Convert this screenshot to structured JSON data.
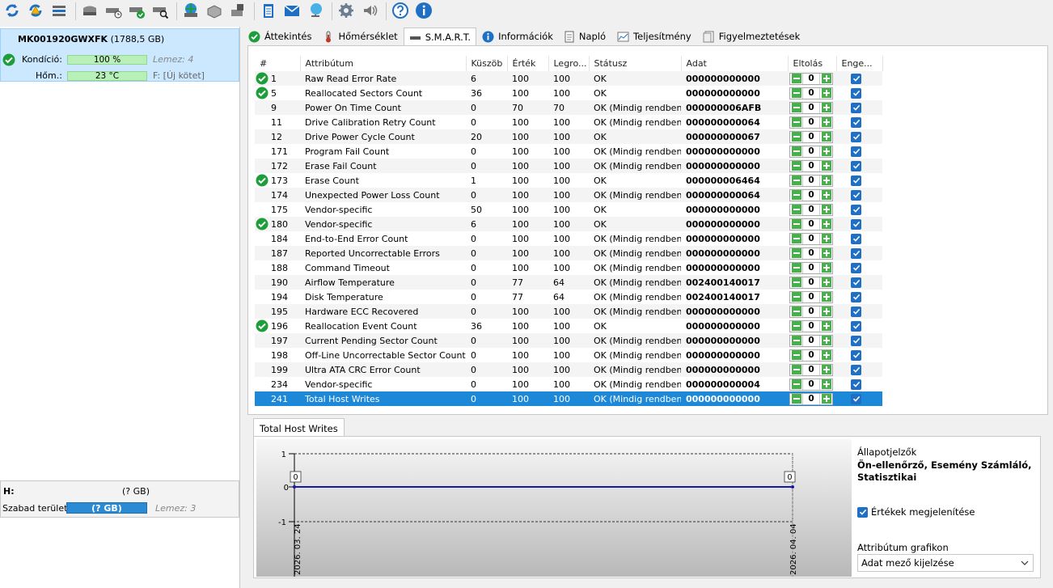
{
  "toolbar": {
    "icons": [
      "refresh-icon",
      "refresh-warning-icon",
      "disk-list-icon",
      "drive-icon",
      "drive-clock-icon",
      "drive-check-icon",
      "drive-search-icon",
      "network-drive-icon",
      "drive-alt-icon",
      "drive-export-icon",
      "notepad-icon",
      "mail-icon",
      "network-icon",
      "settings-icon",
      "speaker-icon",
      "help-icon",
      "info-icon"
    ]
  },
  "drive": {
    "model": "MK001920GWXFK",
    "size": "(1788,5 GB)",
    "condition_label": "Kondíció:",
    "condition_value": "100 %",
    "condition_percent": 100,
    "disk_label": "Lemez: 4",
    "temp_label": "Hőm.:",
    "temp_value": "23 °C",
    "volume_label": "F: [Új kötet]"
  },
  "volume": {
    "letter": "H:",
    "size": "(? GB)",
    "free_label": "Szabad terület",
    "free_value": "(? GB)",
    "disk_label": "Lemez: 3"
  },
  "tabs": [
    {
      "label": "Áttekintés",
      "icon": "check-icon"
    },
    {
      "label": "Hőmérséklet",
      "icon": "thermometer-icon"
    },
    {
      "label": "S.M.A.R.T.",
      "icon": "drive-icon",
      "active": true
    },
    {
      "label": "Információk",
      "icon": "info-icon"
    },
    {
      "label": "Napló",
      "icon": "document-icon"
    },
    {
      "label": "Teljesítmény",
      "icon": "performance-icon"
    },
    {
      "label": "Figyelmeztetések",
      "icon": "warning-list-icon"
    }
  ],
  "table": {
    "headers": [
      "#",
      "Attribútum",
      "Küszöb",
      "Érték",
      "Legro...",
      "Státusz",
      "Adat",
      "Eltolás",
      "Enge..."
    ],
    "rows": [
      {
        "id": "1",
        "name": "Raw Read Error Rate",
        "threshold": "6",
        "value": "100",
        "worst": "100",
        "status": "OK",
        "data": "000000000000",
        "offset": "0",
        "ok": true
      },
      {
        "id": "5",
        "name": "Reallocated Sectors Count",
        "threshold": "36",
        "value": "100",
        "worst": "100",
        "status": "OK",
        "data": "000000000000",
        "offset": "0",
        "ok": true
      },
      {
        "id": "9",
        "name": "Power On Time Count",
        "threshold": "0",
        "value": "70",
        "worst": "70",
        "status": "OK (Mindig rendben)",
        "data": "000000006AFB",
        "offset": "0",
        "ok": false
      },
      {
        "id": "11",
        "name": "Drive Calibration Retry Count",
        "threshold": "0",
        "value": "100",
        "worst": "100",
        "status": "OK (Mindig rendben)",
        "data": "000000000064",
        "offset": "0",
        "ok": false
      },
      {
        "id": "12",
        "name": "Drive Power Cycle Count",
        "threshold": "20",
        "value": "100",
        "worst": "100",
        "status": "OK",
        "data": "000000000067",
        "offset": "0",
        "ok": false
      },
      {
        "id": "171",
        "name": "Program Fail Count",
        "threshold": "0",
        "value": "100",
        "worst": "100",
        "status": "OK (Mindig rendben)",
        "data": "000000000000",
        "offset": "0",
        "ok": false
      },
      {
        "id": "172",
        "name": "Erase Fail Count",
        "threshold": "0",
        "value": "100",
        "worst": "100",
        "status": "OK (Mindig rendben)",
        "data": "000000000000",
        "offset": "0",
        "ok": false
      },
      {
        "id": "173",
        "name": "Erase Count",
        "threshold": "1",
        "value": "100",
        "worst": "100",
        "status": "OK",
        "data": "000000006464",
        "offset": "0",
        "ok": true
      },
      {
        "id": "174",
        "name": "Unexpected Power Loss Count",
        "threshold": "0",
        "value": "100",
        "worst": "100",
        "status": "OK (Mindig rendben)",
        "data": "000000000064",
        "offset": "0",
        "ok": false
      },
      {
        "id": "175",
        "name": "Vendor-specific",
        "threshold": "50",
        "value": "100",
        "worst": "100",
        "status": "OK",
        "data": "000000000000",
        "offset": "0",
        "ok": false
      },
      {
        "id": "180",
        "name": "Vendor-specific",
        "threshold": "6",
        "value": "100",
        "worst": "100",
        "status": "OK",
        "data": "000000000000",
        "offset": "0",
        "ok": true
      },
      {
        "id": "184",
        "name": "End-to-End Error Count",
        "threshold": "0",
        "value": "100",
        "worst": "100",
        "status": "OK (Mindig rendben)",
        "data": "000000000000",
        "offset": "0",
        "ok": false
      },
      {
        "id": "187",
        "name": "Reported Uncorrectable Errors",
        "threshold": "0",
        "value": "100",
        "worst": "100",
        "status": "OK (Mindig rendben)",
        "data": "000000000000",
        "offset": "0",
        "ok": false
      },
      {
        "id": "188",
        "name": "Command Timeout",
        "threshold": "0",
        "value": "100",
        "worst": "100",
        "status": "OK (Mindig rendben)",
        "data": "000000000000",
        "offset": "0",
        "ok": false
      },
      {
        "id": "190",
        "name": "Airflow Temperature",
        "threshold": "0",
        "value": "77",
        "worst": "64",
        "status": "OK (Mindig rendben)",
        "data": "002400140017",
        "offset": "0",
        "ok": false
      },
      {
        "id": "194",
        "name": "Disk Temperature",
        "threshold": "0",
        "value": "77",
        "worst": "64",
        "status": "OK (Mindig rendben)",
        "data": "002400140017",
        "offset": "0",
        "ok": false
      },
      {
        "id": "195",
        "name": "Hardware ECC Recovered",
        "threshold": "0",
        "value": "100",
        "worst": "100",
        "status": "OK (Mindig rendben)",
        "data": "000000000000",
        "offset": "0",
        "ok": false
      },
      {
        "id": "196",
        "name": "Reallocation Event Count",
        "threshold": "36",
        "value": "100",
        "worst": "100",
        "status": "OK",
        "data": "000000000000",
        "offset": "0",
        "ok": true
      },
      {
        "id": "197",
        "name": "Current Pending Sector Count",
        "threshold": "0",
        "value": "100",
        "worst": "100",
        "status": "OK (Mindig rendben)",
        "data": "000000000000",
        "offset": "0",
        "ok": false
      },
      {
        "id": "198",
        "name": "Off-Line Uncorrectable Sector Count",
        "threshold": "0",
        "value": "100",
        "worst": "100",
        "status": "OK (Mindig rendben)",
        "data": "000000000000",
        "offset": "0",
        "ok": false
      },
      {
        "id": "199",
        "name": "Ultra ATA CRC Error Count",
        "threshold": "0",
        "value": "100",
        "worst": "100",
        "status": "OK (Mindig rendben)",
        "data": "000000000000",
        "offset": "0",
        "ok": false
      },
      {
        "id": "234",
        "name": "Vendor-specific",
        "threshold": "0",
        "value": "100",
        "worst": "100",
        "status": "OK (Mindig rendben)",
        "data": "000000000004",
        "offset": "0",
        "ok": false
      },
      {
        "id": "241",
        "name": "Total Host Writes",
        "threshold": "0",
        "value": "100",
        "worst": "100",
        "status": "OK (Mindig rendben)",
        "data": "000000000000",
        "offset": "0",
        "ok": false,
        "selected": true
      }
    ]
  },
  "graph": {
    "tab_label": "Total Host Writes",
    "y_top": "1",
    "y_mid": "0",
    "y_bottom": "-1",
    "x_start": "2026. 03. 24",
    "x_end": "2026. 04. 04",
    "start_value": "0",
    "end_value": "0",
    "line_color": "#1a1aa0"
  },
  "side": {
    "flags_label": "Állapotjelzők",
    "flags_value": "Ön-ellenőrző, Esemény Számláló, Statisztikai",
    "show_values_label": "Értékek megjelenítése",
    "show_values_checked": true,
    "graph_label": "Attribútum grafikon",
    "graph_select": "Adat mező kijelzése"
  },
  "colors": {
    "selection": "#1e88d8",
    "ok_green": "#1e9e3a",
    "bar_green": "#b9f0b9",
    "free_blue": "#2a8ad4"
  }
}
